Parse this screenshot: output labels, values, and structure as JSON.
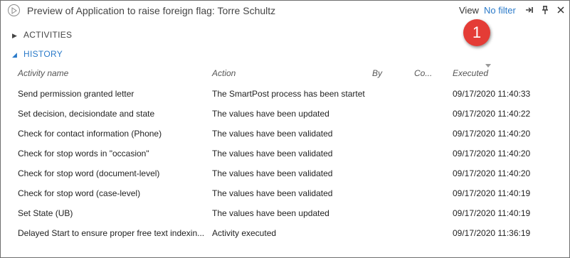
{
  "title": "Preview of Application to raise foreign flag: Torre Schultz",
  "toolbar": {
    "view_label": "View",
    "filter_value": "No filter"
  },
  "badge": "1",
  "sections": {
    "activities": "ACTIVITIES",
    "history": "HISTORY"
  },
  "columns": {
    "activity_name": "Activity name",
    "action": "Action",
    "by": "By",
    "comment": "Co...",
    "executed": "Executed"
  },
  "rows": [
    {
      "name": "Send permission granted letter",
      "action": "The SmartPost process has been startet",
      "executed": "09/17/2020 11:40:33"
    },
    {
      "name": "Set decision, decisiondate and state",
      "action": "The values have been updated",
      "executed": "09/17/2020 11:40:22"
    },
    {
      "name": "Check for contact information (Phone)",
      "action": "The values have been validated",
      "executed": "09/17/2020 11:40:20"
    },
    {
      "name": "Check for stop words in \"occasion\"",
      "action": "The values have been validated",
      "executed": "09/17/2020 11:40:20"
    },
    {
      "name": "Check for stop word (document-level)",
      "action": "The values have been validated",
      "executed": "09/17/2020 11:40:20"
    },
    {
      "name": "Check for stop word (case-level)",
      "action": "The values have been validated",
      "executed": "09/17/2020 11:40:19"
    },
    {
      "name": "Set State (UB)",
      "action": "The values have been updated",
      "executed": "09/17/2020 11:40:19"
    },
    {
      "name": "Delayed Start to ensure proper free text indexin...",
      "action": "Activity executed",
      "executed": "09/17/2020 11:36:19"
    }
  ],
  "colors": {
    "accent": "#2a7ac9",
    "badge": "#e43c36"
  },
  "icons": [
    "play-icon",
    "pin-right-icon",
    "pin-icon",
    "close-icon",
    "triangle-right-icon",
    "triangle-down-icon"
  ]
}
